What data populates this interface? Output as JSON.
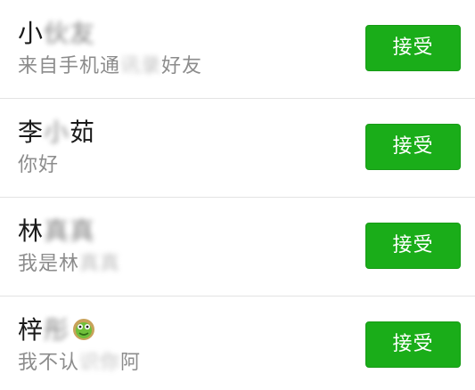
{
  "colors": {
    "accept_button_bg": "#1aad19",
    "name_text": "#1a1a1a",
    "message_text": "#8c8c8c",
    "divider": "#e3e3e3"
  },
  "requests": [
    {
      "name_visible": "小",
      "name_obscured": "伙友",
      "message_prefix": "来自手机通",
      "message_obscured": "讯录",
      "message_suffix": "好友",
      "accept_label": "接受"
    },
    {
      "name_visible": "李",
      "name_obscured": "小",
      "name_suffix": "茹",
      "message": "你好",
      "accept_label": "接受"
    },
    {
      "name_visible": "林",
      "name_obscured": "真真",
      "message_prefix": "我是林",
      "message_obscured": "真真",
      "accept_label": "接受"
    },
    {
      "name_visible": "梓",
      "name_obscured": "彤",
      "name_icon": "frog-emoji-icon",
      "message_prefix": "我不认",
      "message_obscured": "识你",
      "message_suffix": "阿",
      "accept_label": "接受"
    }
  ]
}
